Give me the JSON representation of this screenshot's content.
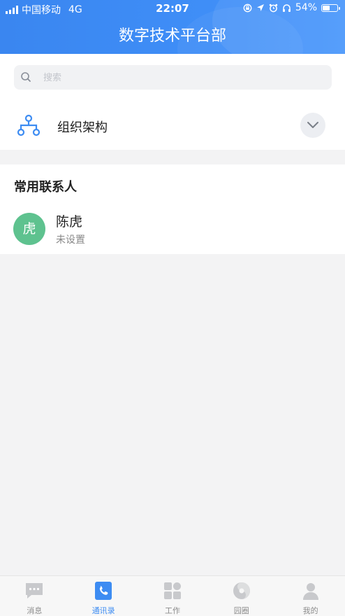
{
  "status_bar": {
    "carrier": "中国移动",
    "network": "4G",
    "time": "22:07",
    "battery": "54%",
    "battery_level": 0.54
  },
  "header": {
    "title": "数字技术平台部"
  },
  "search": {
    "placeholder": "搜索",
    "icon": "search-icon"
  },
  "org": {
    "label": "组织架构",
    "icon": "org-chart-icon",
    "toggle_icon": "chevron-down-icon"
  },
  "frequent_contacts": {
    "title": "常用联系人",
    "items": [
      {
        "avatar_text": "虎",
        "name": "陈虎",
        "subtitle": "未设置",
        "avatar_color": "#5ec28f"
      }
    ]
  },
  "tabbar": {
    "items": [
      {
        "label": "消息",
        "icon": "message-icon",
        "active": false
      },
      {
        "label": "通讯录",
        "icon": "contacts-icon",
        "active": true
      },
      {
        "label": "工作",
        "icon": "apps-grid-icon",
        "active": false
      },
      {
        "label": "园圈",
        "icon": "circle-icon",
        "active": false
      },
      {
        "label": "我的",
        "icon": "profile-icon",
        "active": false
      }
    ]
  },
  "colors": {
    "brand": "#3d8cf2",
    "avatar_green": "#5ec28f",
    "tab_inactive": "#8c8c8c"
  }
}
